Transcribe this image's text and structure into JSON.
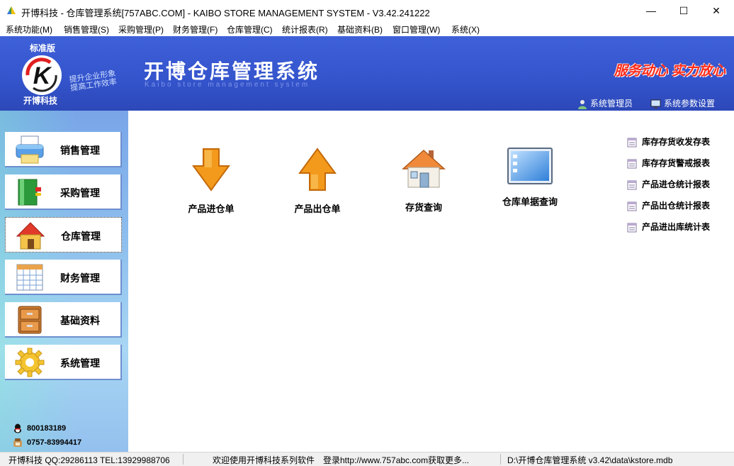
{
  "window": {
    "title": "开博科技 - 仓库管理系统[757ABC.COM] - KAIBO STORE MANAGEMENT SYSTEM - V3.42.241222",
    "minimize": "—",
    "maximize": "☐",
    "close": "✕"
  },
  "menu": [
    "系统功能(M)",
    "销售管理(S)",
    "采购管理(P)",
    "财务管理(F)",
    "仓库管理(C)",
    "统计报表(R)",
    "基础资料(B)",
    "窗口管理(W)",
    "系统(X)"
  ],
  "banner": {
    "edition": "标准版",
    "logo_letter": "K",
    "company": "开博科技",
    "slogan_line1": "提升企业形象",
    "slogan_line2": "提高工作效率",
    "title": "开博仓库管理系统",
    "subtitle": "Kaibo store management system",
    "motto": "服务动心 实力放心",
    "user_link": "系统管理员",
    "settings_link": "系统参数设置"
  },
  "sidebar": {
    "items": [
      {
        "label": "销售管理",
        "icon": "printer-icon"
      },
      {
        "label": "采购管理",
        "icon": "book-icon"
      },
      {
        "label": "仓库管理",
        "icon": "house-icon",
        "active": true
      },
      {
        "label": "财务管理",
        "icon": "calendar-icon"
      },
      {
        "label": "基础资料",
        "icon": "cabinet-icon"
      },
      {
        "label": "系统管理",
        "icon": "gear-icon"
      }
    ],
    "qq": "800183189",
    "phone": "0757-83994417"
  },
  "main": {
    "tiles": [
      {
        "label": "产品进仓单",
        "icon": "arrow-down-icon"
      },
      {
        "label": "产品出仓单",
        "icon": "arrow-up-icon"
      },
      {
        "label": "存货查询",
        "icon": "house-icon"
      },
      {
        "label": "仓库单据查询",
        "icon": "window-icon"
      }
    ],
    "reports": [
      "库存存货收发存表",
      "库存存货警戒报表",
      "产品进仓统计报表",
      "产品出仓统计报表",
      "产品进出库统计表"
    ]
  },
  "status": {
    "contact": "开博科技 QQ:29286113 TEL:13929988706",
    "welcome": "欢迎使用开博科技系列软件",
    "login_hint": "登录http://www.757abc.com获取更多...",
    "db_path": "D:\\开博仓库管理系统 v3.42\\data\\kstore.mdb"
  },
  "colors": {
    "banner_blue": "#3454cc",
    "motto_red": "#ff2a1a",
    "arrow_orange": "#f39a1c"
  }
}
